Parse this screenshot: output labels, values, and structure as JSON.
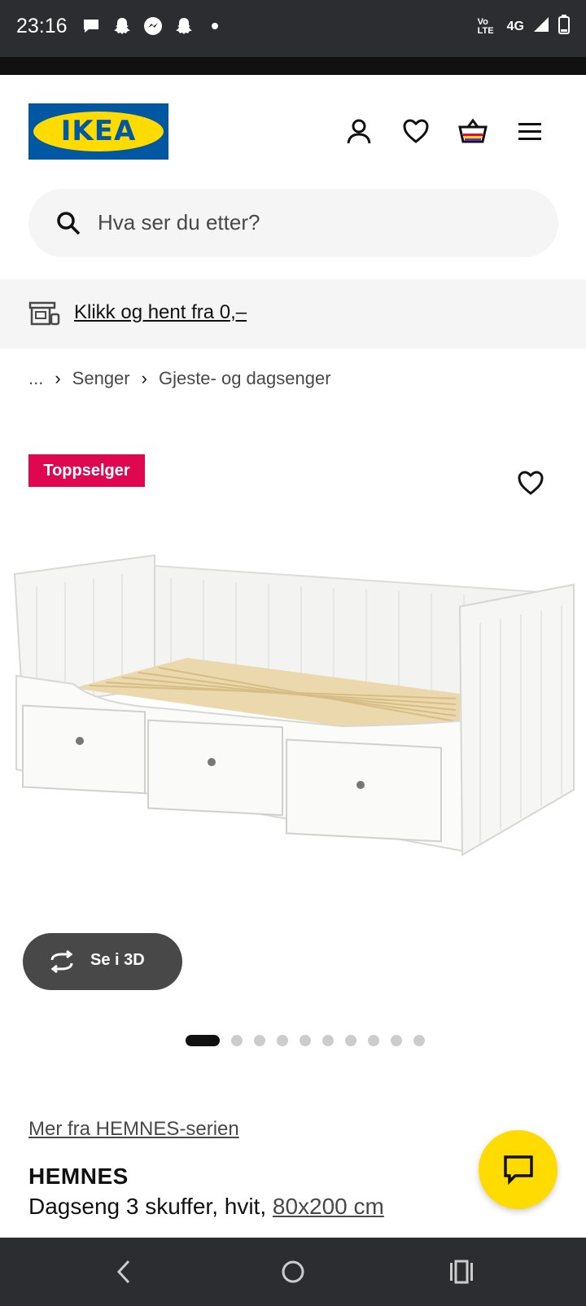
{
  "status_bar": {
    "time": "23:16",
    "network": "4G",
    "volte": "Vo LTE"
  },
  "header": {
    "logo_text": "IKEA",
    "icons": [
      "user-icon",
      "heart-icon",
      "shopping-bag-icon",
      "menu-icon"
    ]
  },
  "search": {
    "placeholder": "Hva ser du etter?"
  },
  "promo": {
    "text": "Klikk og hent fra 0,–"
  },
  "breadcrumb": {
    "ellipsis": "...",
    "items": [
      "Senger",
      "Gjeste- og dagsenger"
    ]
  },
  "product": {
    "badge": "Toppselger",
    "view_3d_label": "Se i 3D",
    "carousel": {
      "total": 10,
      "active_index": 0
    },
    "series_link": "Mer fra HEMNES-serien",
    "name": "HEMNES",
    "description": "Dagseng 3 skuffer, hvit, ",
    "size": "80x200 cm"
  },
  "colors": {
    "brand_blue": "#0058a3",
    "brand_yellow": "#ffdb00",
    "badge_red": "#e00751"
  }
}
